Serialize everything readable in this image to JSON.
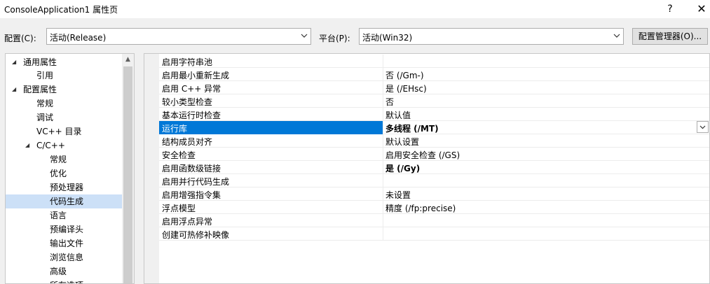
{
  "window": {
    "title": "ConsoleApplication1 属性页",
    "help_label": "?",
    "close_label": "✕"
  },
  "config_bar": {
    "config_label": "配置(C):",
    "config_value": "活动(Release)",
    "platform_label": "平台(P):",
    "platform_value": "活动(Win32)",
    "manager_label": "配置管理器(O)..."
  },
  "tree": {
    "items": [
      {
        "label": "通用属性",
        "expanded": true
      },
      {
        "label": "引用"
      },
      {
        "label": "配置属性",
        "expanded": true
      },
      {
        "label": "常规"
      },
      {
        "label": "调试"
      },
      {
        "label": "VC++ 目录"
      },
      {
        "label": "C/C++",
        "expanded": true
      },
      {
        "label": "常规"
      },
      {
        "label": "优化"
      },
      {
        "label": "预处理器"
      },
      {
        "label": "代码生成",
        "selected": true
      },
      {
        "label": "语言"
      },
      {
        "label": "预编译头"
      },
      {
        "label": "输出文件"
      },
      {
        "label": "浏览信息"
      },
      {
        "label": "高级"
      },
      {
        "label": "所有选项"
      }
    ]
  },
  "properties": {
    "rows": [
      {
        "name": "启用字符串池",
        "value": ""
      },
      {
        "name": "启用最小重新生成",
        "value": "否 (/Gm-)"
      },
      {
        "name": "启用 C++ 异常",
        "value": "是 (/EHsc)"
      },
      {
        "name": "较小类型检查",
        "value": "否"
      },
      {
        "name": "基本运行时检查",
        "value": "默认值"
      },
      {
        "name": "运行库",
        "value": "多线程 (/MT)",
        "bold": true,
        "selected": true
      },
      {
        "name": "结构成员对齐",
        "value": "默认设置"
      },
      {
        "name": "安全检查",
        "value": "启用安全检查 (/GS)"
      },
      {
        "name": "启用函数级链接",
        "value": "是 (/Gy)",
        "bold": true
      },
      {
        "name": "启用并行代码生成",
        "value": ""
      },
      {
        "name": "启用增强指令集",
        "value": "未设置"
      },
      {
        "name": "浮点模型",
        "value": "精度 (/fp:precise)"
      },
      {
        "name": "启用浮点异常",
        "value": ""
      },
      {
        "name": "创建可热修补映像",
        "value": ""
      }
    ]
  },
  "colors": {
    "selection_blue": "#0078d7",
    "tree_selection": "#cce0f7",
    "window_bg": "#f0f0f0"
  }
}
